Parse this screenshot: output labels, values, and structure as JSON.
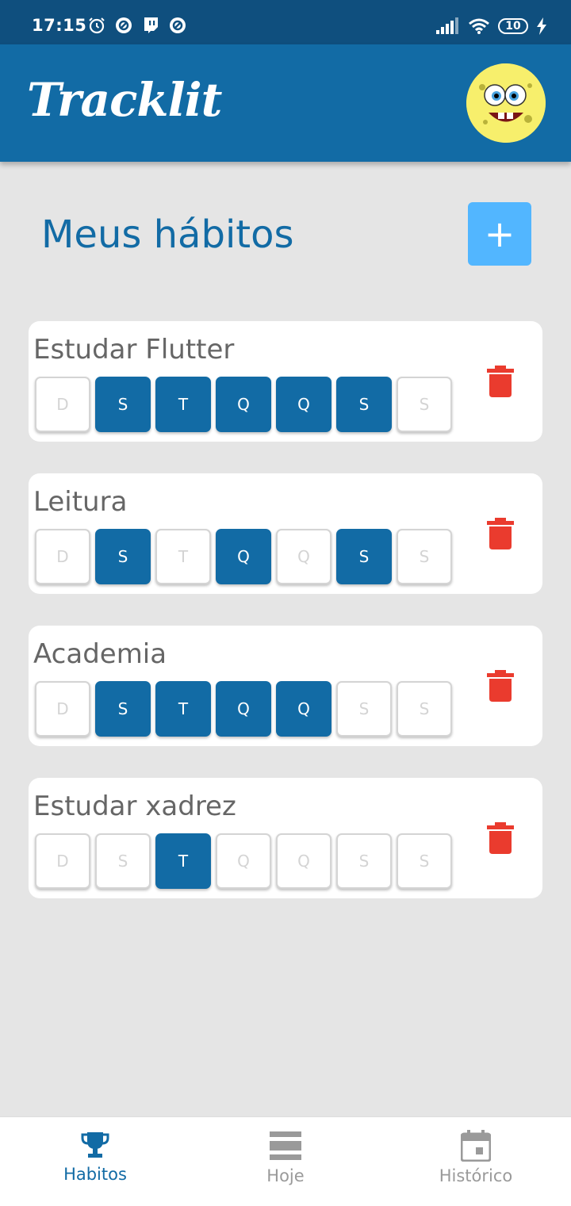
{
  "status_bar": {
    "time": "17:15",
    "battery": "10",
    "icons": [
      "alarm-icon",
      "notification-icon",
      "twitch-icon",
      "notification-icon",
      "signal-icon",
      "wifi-icon",
      "battery-icon",
      "charging-icon"
    ]
  },
  "app": {
    "title": "Tracklit"
  },
  "header": {
    "title": "Meus hábitos",
    "add_label": "+"
  },
  "habits": [
    {
      "name": "Estudar Flutter",
      "days": [
        "D",
        "S",
        "T",
        "Q",
        "Q",
        "S",
        "S"
      ],
      "active": [
        false,
        true,
        true,
        true,
        true,
        true,
        false
      ]
    },
    {
      "name": "Leitura",
      "days": [
        "D",
        "S",
        "T",
        "Q",
        "Q",
        "S",
        "S"
      ],
      "active": [
        false,
        true,
        false,
        true,
        false,
        true,
        false
      ]
    },
    {
      "name": "Academia",
      "days": [
        "D",
        "S",
        "T",
        "Q",
        "Q",
        "S",
        "S"
      ],
      "active": [
        false,
        true,
        true,
        true,
        true,
        false,
        false
      ]
    },
    {
      "name": "Estudar xadrez",
      "days": [
        "D",
        "S",
        "T",
        "Q",
        "Q",
        "S",
        "S"
      ],
      "active": [
        false,
        false,
        true,
        false,
        false,
        false,
        false
      ]
    }
  ],
  "nav": {
    "items": [
      {
        "label": "Habitos",
        "icon": "trophy-icon",
        "active": true
      },
      {
        "label": "Hoje",
        "icon": "list-icon",
        "active": false
      },
      {
        "label": "Histórico",
        "icon": "calendar-icon",
        "active": false
      }
    ]
  },
  "colors": {
    "primary": "#126ba5",
    "status_bar": "#0f4f7e",
    "accent": "#52b6ff",
    "delete": "#ea3b2e",
    "background": "#e5e5e5"
  }
}
